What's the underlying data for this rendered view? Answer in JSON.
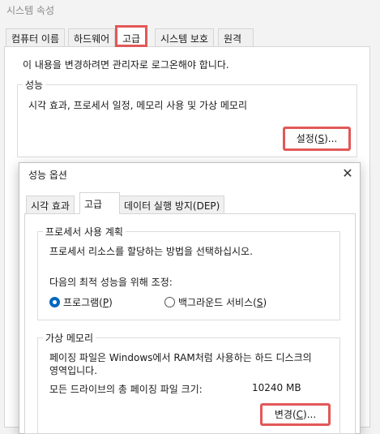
{
  "window": {
    "title": "시스템 속성",
    "tabs": [
      "컴퓨터 이름",
      "하드웨어",
      "고급",
      "시스템 보호",
      "원격"
    ],
    "admin_notice": "이 내용을 변경하려면 관리자로 로그온해야 합니다.",
    "performance_group": {
      "label": "성능",
      "description": "시각 효과, 프로세서 일정, 메모리 사용 및 가상 메모리",
      "settings_button_prefix": "설정(",
      "settings_button_key": "S",
      "settings_button_suffix": ")..."
    }
  },
  "dialog": {
    "title": "성능 옵션",
    "close_glyph": "✕",
    "tabs": [
      "시각 효과",
      "고급",
      "데이터 실행 방지(DEP)"
    ],
    "processor": {
      "label": "프로세서 사용 계획",
      "description": "프로세서 리소스를 할당하는 방법을 선택하십시오.",
      "adjust_label": "다음의 최적 성능을 위해 조정:",
      "option_programs_prefix": "프로그램(",
      "option_programs_key": "P",
      "option_programs_suffix": ")",
      "option_services_prefix": "백그라운드 서비스(",
      "option_services_key": "S",
      "option_services_suffix": ")",
      "selected": "programs"
    },
    "virtual_memory": {
      "label": "가상 메모리",
      "description_line1": "페이징 파일은 Windows에서 RAM처럼 사용하는 하드 디스크의",
      "description_line2": "영역입니다.",
      "total_label": "모든 드라이브의 총 페이징 파일 크기:",
      "total_value": "10240 MB",
      "change_button_prefix": "변경(",
      "change_button_key": "C",
      "change_button_suffix": ")..."
    }
  },
  "colors": {
    "highlight": "#e25858",
    "accent": "#0067c0"
  }
}
